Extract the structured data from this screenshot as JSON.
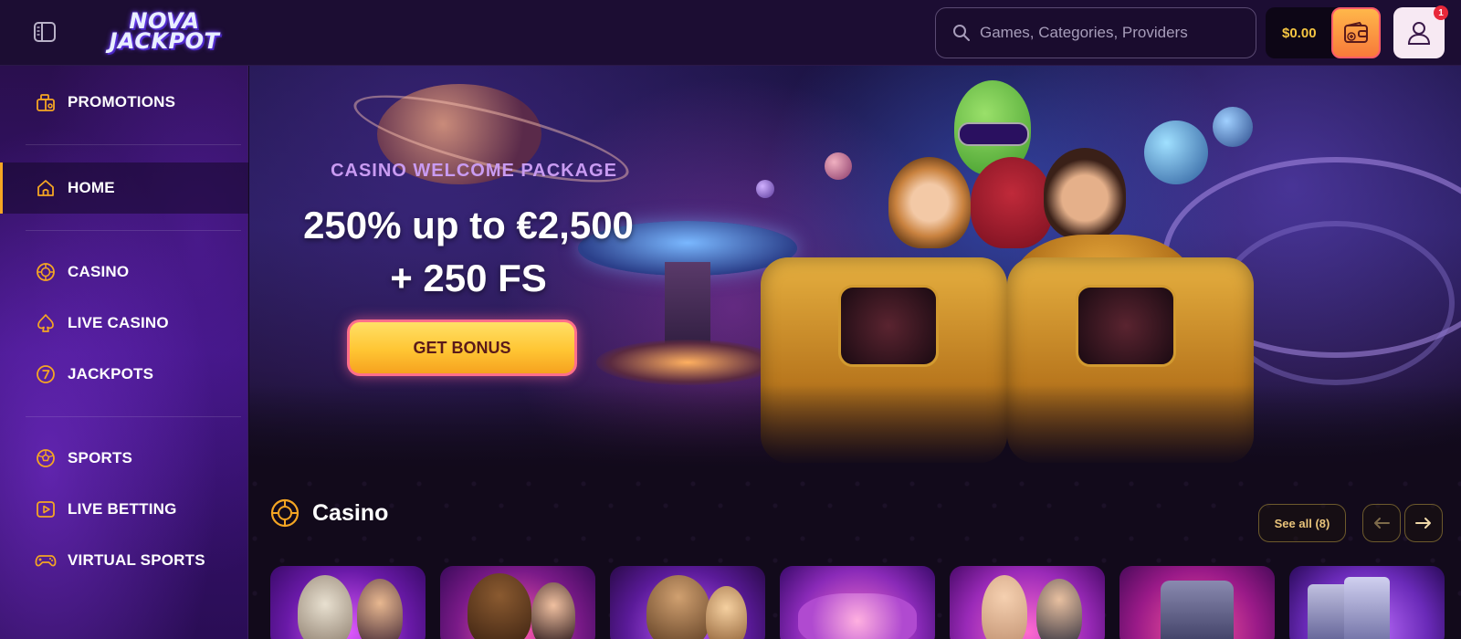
{
  "header": {
    "logo_line1": "NOVA",
    "logo_line2": "JACKPOT",
    "search_placeholder": "Games, Categories, Providers",
    "balance": "$0.00",
    "notification_count": "1"
  },
  "sidebar": {
    "items": [
      {
        "label": "PROMOTIONS",
        "icon": "promotions-icon"
      },
      {
        "label": "HOME",
        "icon": "home-icon",
        "active": true
      },
      {
        "label": "CASINO",
        "icon": "casino-chip-icon"
      },
      {
        "label": "LIVE CASINO",
        "icon": "spade-icon"
      },
      {
        "label": "JACKPOTS",
        "icon": "jackpot-seven-icon"
      },
      {
        "label": "SPORTS",
        "icon": "soccer-ball-icon"
      },
      {
        "label": "LIVE BETTING",
        "icon": "play-icon"
      },
      {
        "label": "VIRTUAL SPORTS",
        "icon": "gamepad-icon"
      }
    ]
  },
  "hero": {
    "subtitle": "CASINO WELCOME PACKAGE",
    "title_line1": "250% up to €2,500",
    "title_line2": "+ 250 FS",
    "button_label": "GET BONUS"
  },
  "casino_section": {
    "title": "Casino",
    "see_all_label": "See all (8)"
  },
  "colors": {
    "accent": "#f5a623",
    "balance": "#f5c542",
    "sidebar_bg": "#3b137a",
    "header_bg": "#1c0d33"
  }
}
